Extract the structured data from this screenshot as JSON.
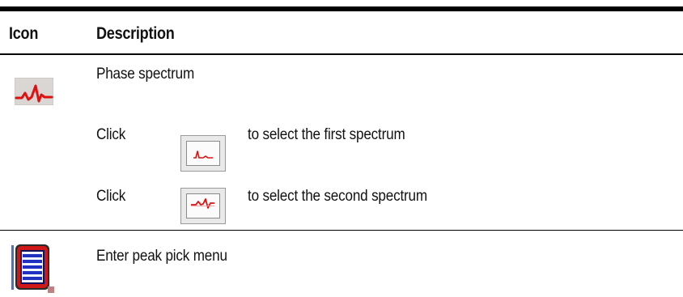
{
  "table": {
    "headers": {
      "icon": "Icon",
      "description": "Description"
    },
    "rows": [
      {
        "icon": "phase-spectrum-icon",
        "description": "Phase spectrum",
        "sub_items": [
          {
            "prefix": "Click",
            "icon": "select-first-spectrum-icon",
            "text": "to select the first spectrum"
          },
          {
            "prefix": "Click",
            "icon": "select-second-spectrum-icon",
            "text": "to select the second spectrum"
          }
        ]
      },
      {
        "icon": "peak-pick-menu-icon",
        "description": "Enter peak pick menu"
      }
    ]
  },
  "colors": {
    "rule": "#000000",
    "icon_red": "#e01010",
    "menu_blue": "#2030c0"
  }
}
